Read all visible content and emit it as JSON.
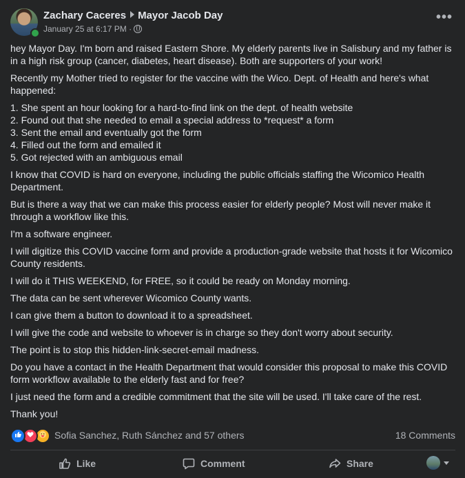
{
  "post": {
    "author": "Zachary Caceres",
    "target": "Mayor Jacob Day",
    "timestamp": "January 25 at 6:17 PM",
    "separator": "·",
    "privacy_icon": "globe-icon",
    "more_icon": "more-icon",
    "more_label": "•••",
    "paragraphs": [
      "hey Mayor Day. I'm born and raised Eastern Shore. My elderly parents live in Salisbury and my father is in a high risk group (cancer, diabetes, heart disease). Both are supporters of your work!",
      "Recently my Mother tried to register for the vaccine with the Wico. Dept. of Health and here's what happened:",
      "I know that COVID is hard on everyone, including the public officials staffing the Wicomico Health Department.",
      "But is there a way that we can make this process easier for elderly people? Most will never make it through a workflow like this.",
      "I'm a software engineer.",
      "I will digitize this COVID vaccine form and provide a production-grade website that hosts it for Wicomico County residents.",
      "I will do it THIS WEEKEND, for FREE, so it could be ready on Monday morning.",
      "The data can be sent wherever Wicomico County wants.",
      "I can give them a button to download it to a spreadsheet.",
      "I will give the code and website to whoever is in charge so they don't worry about security.",
      "The point is to stop this hidden-link-secret-email madness.",
      "Do you have a contact in the Health Department that would consider this proposal to make this COVID form workflow available to the elderly fast and for free?",
      "I just need the form and a credible commitment that the site will be used. I'll take care of the rest.",
      "Thank you!"
    ],
    "steps": [
      "1. She spent an hour looking for a hard-to-find link on the dept. of health website",
      "2. Found out that she needed to email a special address to *request* a form",
      "3. Sent the email and eventually got the form",
      "4. Filled out the form and emailed it",
      "5. Got rejected with an ambiguous email"
    ]
  },
  "engagement": {
    "reaction_icons": [
      "like-icon",
      "love-icon",
      "care-icon"
    ],
    "reactions_text": "Sofia Sanchez, Ruth Sánchez and 57 others",
    "comments_text": "18 Comments"
  },
  "actions": {
    "like_label": "Like",
    "comment_label": "Comment",
    "share_label": "Share"
  },
  "colors": {
    "background": "#242526",
    "text_primary": "#e4e6eb",
    "text_secondary": "#b0b3b8",
    "like_blue": "#1877f2",
    "love_red": "#f33e58",
    "care_yellow": "#f7b125",
    "online_green": "#31a24c"
  }
}
